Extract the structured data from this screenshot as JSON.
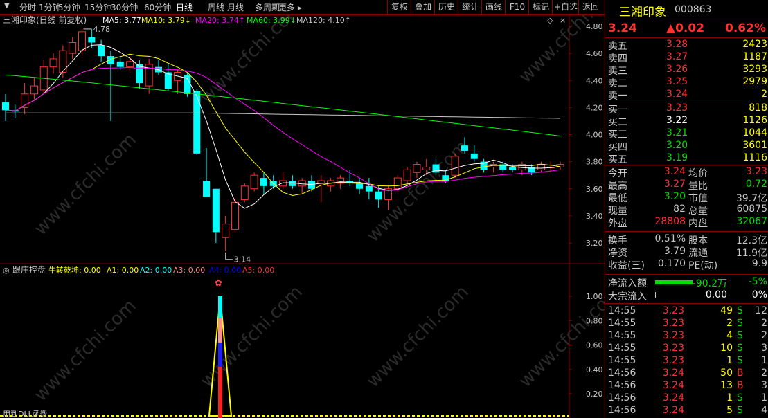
{
  "toolbar": {
    "periods": [
      "分时",
      "1分钟",
      "5分钟",
      "15分钟",
      "30分钟",
      "60分钟",
      "日线",
      "周线",
      "月线",
      "多周期",
      "更多"
    ],
    "right_buttons": [
      "复权",
      "叠加",
      "历史",
      "统计",
      "画线",
      "F10",
      "标记",
      "+自选",
      "返回"
    ]
  },
  "main_chart": {
    "title": "三湘印象(日线 前复权)",
    "ma_labels": [
      {
        "text": "MA5: 3.77",
        "color": "#ffffff"
      },
      {
        "text": "MA10: 3.79↓",
        "color": "#ffff00"
      },
      {
        "text": "MA20: 3.74↑",
        "color": "#ff00ff"
      },
      {
        "text": "MA60: 3.99↓",
        "color": "#00ff00"
      },
      {
        "text": "MA120: 4.10↑",
        "color": "#c8c8c8"
      }
    ],
    "high_label": "4.78",
    "low_label": "3.14",
    "y_ticks": [
      "4.80",
      "4.60",
      "4.40",
      "4.20",
      "4.00",
      "3.80",
      "3.60",
      "3.40",
      "3.20"
    ]
  },
  "indicator": {
    "title": "跟庄控盘",
    "labels": [
      {
        "text": "牛转乾坤: 0.00",
        "color": "#ffff00"
      },
      {
        "text": "A1: 0.00",
        "color": "#ffff00"
      },
      {
        "text": "A2: 0.00",
        "color": "#00ffff"
      },
      {
        "text": "A3: 0.00",
        "color": "#ff8080"
      },
      {
        "text": "A4: 0.00",
        "color": "#0000ff"
      },
      {
        "text": "A5: 0.00",
        "color": "#ff3030"
      }
    ],
    "y_ticks": [
      "1.00",
      "0.80",
      "0.60",
      "0.40",
      "0.20"
    ],
    "footer": "用到DLL函数"
  },
  "watermark": "www.cfchi.com",
  "quote": {
    "name": "三湘印象",
    "code": "000863",
    "price": "3.24",
    "change": "▲0.02",
    "pct": "0.62%",
    "asks": [
      {
        "label": "卖五",
        "price": "3.28",
        "vol": "2423"
      },
      {
        "label": "卖四",
        "price": "3.27",
        "vol": "1187"
      },
      {
        "label": "卖三",
        "price": "3.26",
        "vol": "3293"
      },
      {
        "label": "卖二",
        "price": "3.25",
        "vol": "2979"
      },
      {
        "label": "卖一",
        "price": "3.24",
        "vol": "2"
      }
    ],
    "bids": [
      {
        "label": "买一",
        "price": "3.23",
        "vol": "818",
        "pcolor": "#ff3030"
      },
      {
        "label": "买二",
        "price": "3.22",
        "vol": "1126",
        "pcolor": "#ffffff"
      },
      {
        "label": "买三",
        "price": "3.21",
        "vol": "1044",
        "pcolor": "#00e000"
      },
      {
        "label": "买四",
        "price": "3.20",
        "vol": "3601",
        "pcolor": "#00e000"
      },
      {
        "label": "买五",
        "price": "3.19",
        "vol": "1116",
        "pcolor": "#00e000"
      }
    ],
    "stats1": [
      {
        "l": "今开",
        "v": "3.24",
        "vc": "#ff3030",
        "l2": "均价",
        "v2": "3.23",
        "v2c": "#ff3030"
      },
      {
        "l": "最高",
        "v": "3.27",
        "vc": "#ff3030",
        "l2": "量比",
        "v2": "0.72",
        "v2c": "#00e000"
      },
      {
        "l": "最低",
        "v": "3.20",
        "vc": "#00e000",
        "l2": "市值",
        "v2": "39.7亿",
        "v2c": "#c8c8c8"
      },
      {
        "l": "现量",
        "v": "82",
        "vc": "#c8c8c8",
        "l2": "总量",
        "v2": "60875",
        "v2c": "#c8c8c8"
      },
      {
        "l": "外盘",
        "v": "28808",
        "vc": "#ff3030",
        "l2": "内盘",
        "v2": "32067",
        "v2c": "#00e000"
      }
    ],
    "stats2": [
      {
        "l": "换手",
        "v": "0.51%",
        "l2": "股本",
        "v2": "12.3亿"
      },
      {
        "l": "净资",
        "v": "3.79",
        "l2": "流通",
        "v2": "11.9亿"
      },
      {
        "l": "收益(三)",
        "v": "0.170",
        "l2": "PE(动)",
        "v2": "9.9"
      }
    ],
    "flow": [
      {
        "l": "净流入额",
        "v": "-90.2万",
        "p": "-5%"
      },
      {
        "l": "大宗流入",
        "v": "0.00",
        "p": "0%"
      }
    ],
    "ticks": [
      {
        "t": "14:55",
        "p": "3.23",
        "v": "49",
        "bs": "S",
        "n": "12"
      },
      {
        "t": "14:55",
        "p": "3.23",
        "v": "2",
        "bs": "S",
        "n": "2"
      },
      {
        "t": "14:55",
        "p": "3.23",
        "v": "4",
        "bs": "S",
        "n": "2"
      },
      {
        "t": "14:55",
        "p": "3.23",
        "v": "10",
        "bs": "S",
        "n": "3"
      },
      {
        "t": "14:55",
        "p": "3.23",
        "v": "1",
        "bs": "S",
        "n": "1"
      },
      {
        "t": "14:56",
        "p": "3.24",
        "v": "50",
        "bs": "B",
        "n": "2"
      },
      {
        "t": "14:56",
        "p": "3.24",
        "v": "13",
        "bs": "B",
        "n": "3"
      },
      {
        "t": "14:56",
        "p": "3.24",
        "v": "1",
        "bs": "S",
        "n": "1"
      },
      {
        "t": "14:56",
        "p": "3.24",
        "v": "5",
        "bs": "S",
        "n": "4"
      }
    ]
  },
  "candles": [
    [
      4.24,
      4.3,
      4.1,
      4.18
    ],
    [
      4.18,
      4.22,
      4.12,
      4.17
    ],
    [
      4.2,
      4.38,
      4.15,
      4.3
    ],
    [
      4.3,
      4.42,
      4.26,
      4.36
    ],
    [
      4.33,
      4.55,
      4.3,
      4.5
    ],
    [
      4.5,
      4.6,
      4.45,
      4.56
    ],
    [
      4.46,
      4.66,
      4.42,
      4.62
    ],
    [
      4.6,
      4.72,
      4.56,
      4.68
    ],
    [
      4.62,
      4.78,
      4.58,
      4.76
    ],
    [
      4.72,
      4.78,
      4.64,
      4.68
    ],
    [
      4.66,
      4.7,
      4.54,
      4.58
    ],
    [
      4.58,
      4.62,
      4.1,
      4.52
    ],
    [
      4.54,
      4.58,
      4.48,
      4.5
    ],
    [
      4.5,
      4.58,
      4.46,
      4.54
    ],
    [
      4.52,
      4.55,
      4.34,
      4.38
    ],
    [
      4.36,
      4.56,
      4.3,
      4.52
    ],
    [
      4.5,
      4.55,
      4.44,
      4.46
    ],
    [
      4.46,
      4.52,
      4.32,
      4.34
    ],
    [
      4.4,
      4.48,
      4.3,
      4.46
    ],
    [
      4.44,
      4.46,
      4.28,
      4.3
    ],
    [
      4.32,
      4.34,
      3.85,
      3.86
    ],
    [
      3.66,
      3.9,
      3.54,
      3.54
    ],
    [
      3.6,
      3.6,
      3.2,
      3.28
    ],
    [
      3.24,
      3.4,
      3.14,
      3.34
    ],
    [
      3.3,
      3.54,
      3.28,
      3.5
    ],
    [
      3.52,
      3.64,
      3.5,
      3.62
    ],
    [
      3.6,
      3.72,
      3.58,
      3.7
    ],
    [
      3.68,
      3.72,
      3.56,
      3.62
    ],
    [
      3.66,
      3.7,
      3.6,
      3.62
    ],
    [
      3.62,
      3.72,
      3.6,
      3.66
    ],
    [
      3.66,
      3.7,
      3.6,
      3.62
    ],
    [
      3.62,
      3.68,
      3.56,
      3.66
    ],
    [
      3.66,
      3.7,
      3.58,
      3.6
    ],
    [
      3.64,
      3.7,
      3.5,
      3.66
    ],
    [
      3.62,
      3.68,
      3.58,
      3.66
    ],
    [
      3.64,
      3.7,
      3.6,
      3.68
    ],
    [
      3.66,
      3.74,
      3.62,
      3.64
    ],
    [
      3.64,
      3.68,
      3.56,
      3.6
    ],
    [
      3.62,
      3.68,
      3.52,
      3.58
    ],
    [
      3.58,
      3.62,
      3.46,
      3.52
    ],
    [
      3.52,
      3.62,
      3.44,
      3.6
    ],
    [
      3.6,
      3.7,
      3.58,
      3.68
    ],
    [
      3.66,
      3.76,
      3.62,
      3.74
    ],
    [
      3.72,
      3.8,
      3.68,
      3.78
    ],
    [
      3.74,
      3.82,
      3.7,
      3.76
    ],
    [
      3.78,
      3.82,
      3.7,
      3.72
    ],
    [
      3.7,
      3.74,
      3.64,
      3.66
    ],
    [
      3.7,
      3.86,
      3.68,
      3.84
    ],
    [
      3.92,
      3.98,
      3.86,
      3.88
    ],
    [
      3.86,
      3.92,
      3.8,
      3.82
    ],
    [
      3.8,
      3.82,
      3.72,
      3.74
    ],
    [
      3.76,
      3.8,
      3.72,
      3.78
    ],
    [
      3.78,
      3.8,
      3.72,
      3.74
    ],
    [
      3.76,
      3.78,
      3.72,
      3.74
    ],
    [
      3.74,
      3.8,
      3.7,
      3.78
    ],
    [
      3.76,
      3.78,
      3.7,
      3.72
    ],
    [
      3.74,
      3.8,
      3.72,
      3.78
    ],
    [
      3.76,
      3.8,
      3.72,
      3.76
    ],
    [
      3.76,
      3.8,
      3.74,
      3.78
    ]
  ]
}
